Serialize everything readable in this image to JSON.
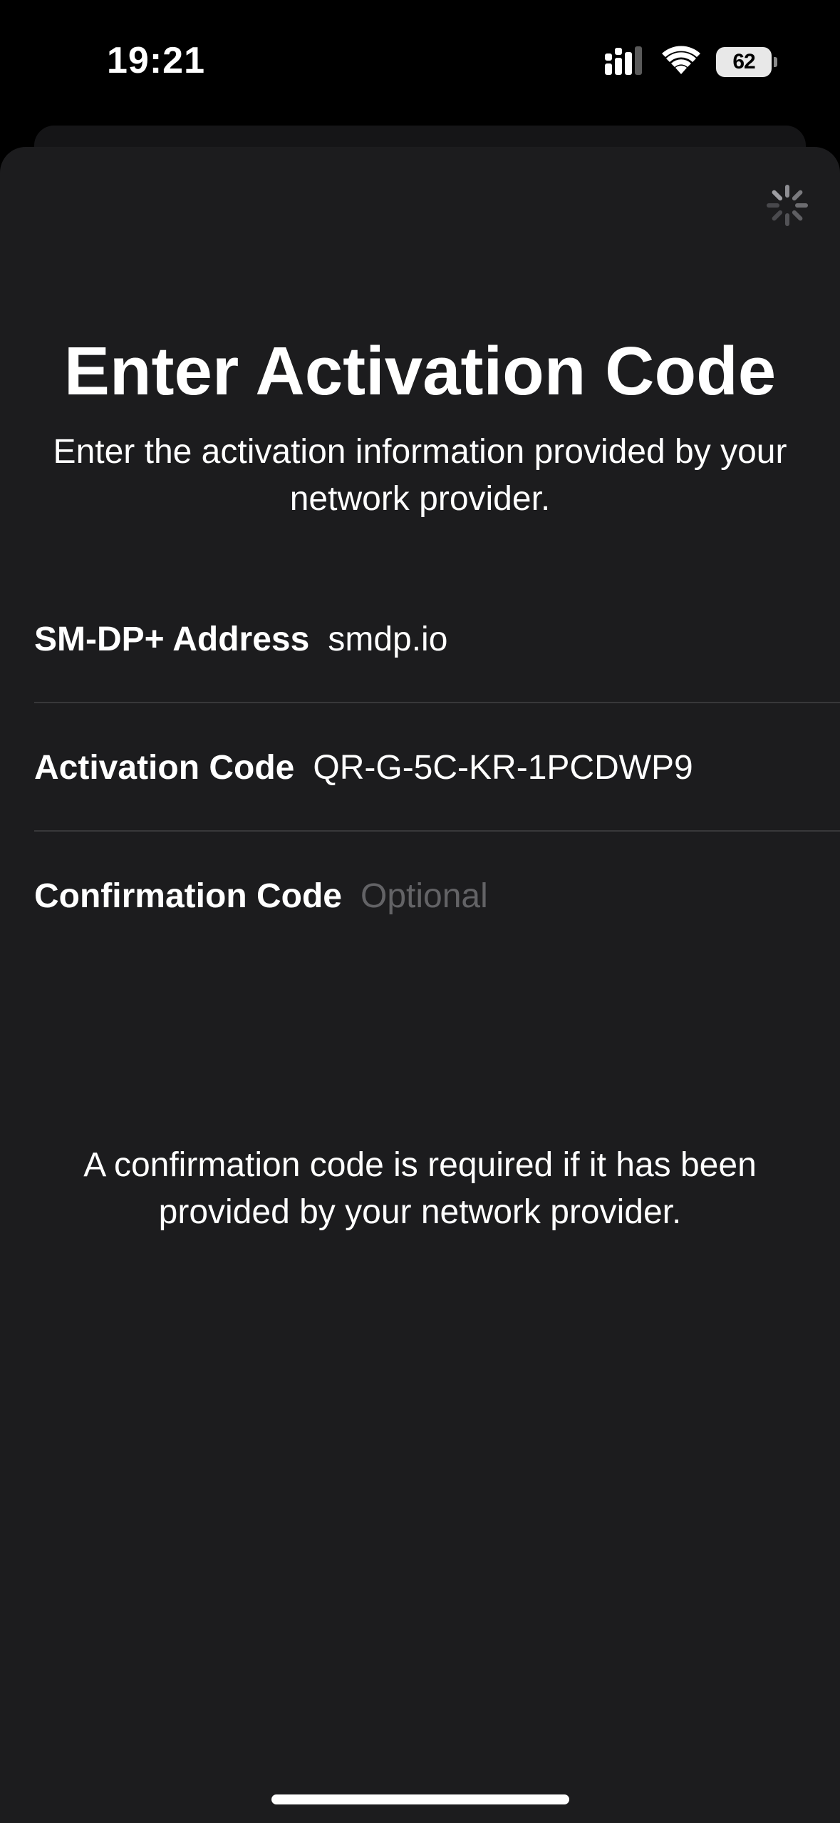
{
  "status_bar": {
    "time": "19:21",
    "battery_level": "62",
    "icons": [
      "cellular-signal-icon",
      "wifi-icon",
      "battery-icon"
    ]
  },
  "sheet": {
    "spinner_icon": "activity-spinner-icon",
    "title": "Enter Activation Code",
    "subtitle": "Enter the activation information provided by your network provider.",
    "fields": [
      {
        "label": "SM-DP+ Address",
        "value": "smdp.io",
        "placeholder": ""
      },
      {
        "label": "Activation Code",
        "value": "QR-G-5C-KR-1PCDWP9",
        "placeholder": ""
      },
      {
        "label": "Confirmation Code",
        "value": "",
        "placeholder": "Optional"
      }
    ],
    "footnote": "A confirmation code is required if it has been provided by your network provider."
  },
  "colors": {
    "background": "#000000",
    "sheet": "#1c1c1e",
    "separator": "#38383a",
    "placeholder": "#636366",
    "text": "#ffffff"
  }
}
